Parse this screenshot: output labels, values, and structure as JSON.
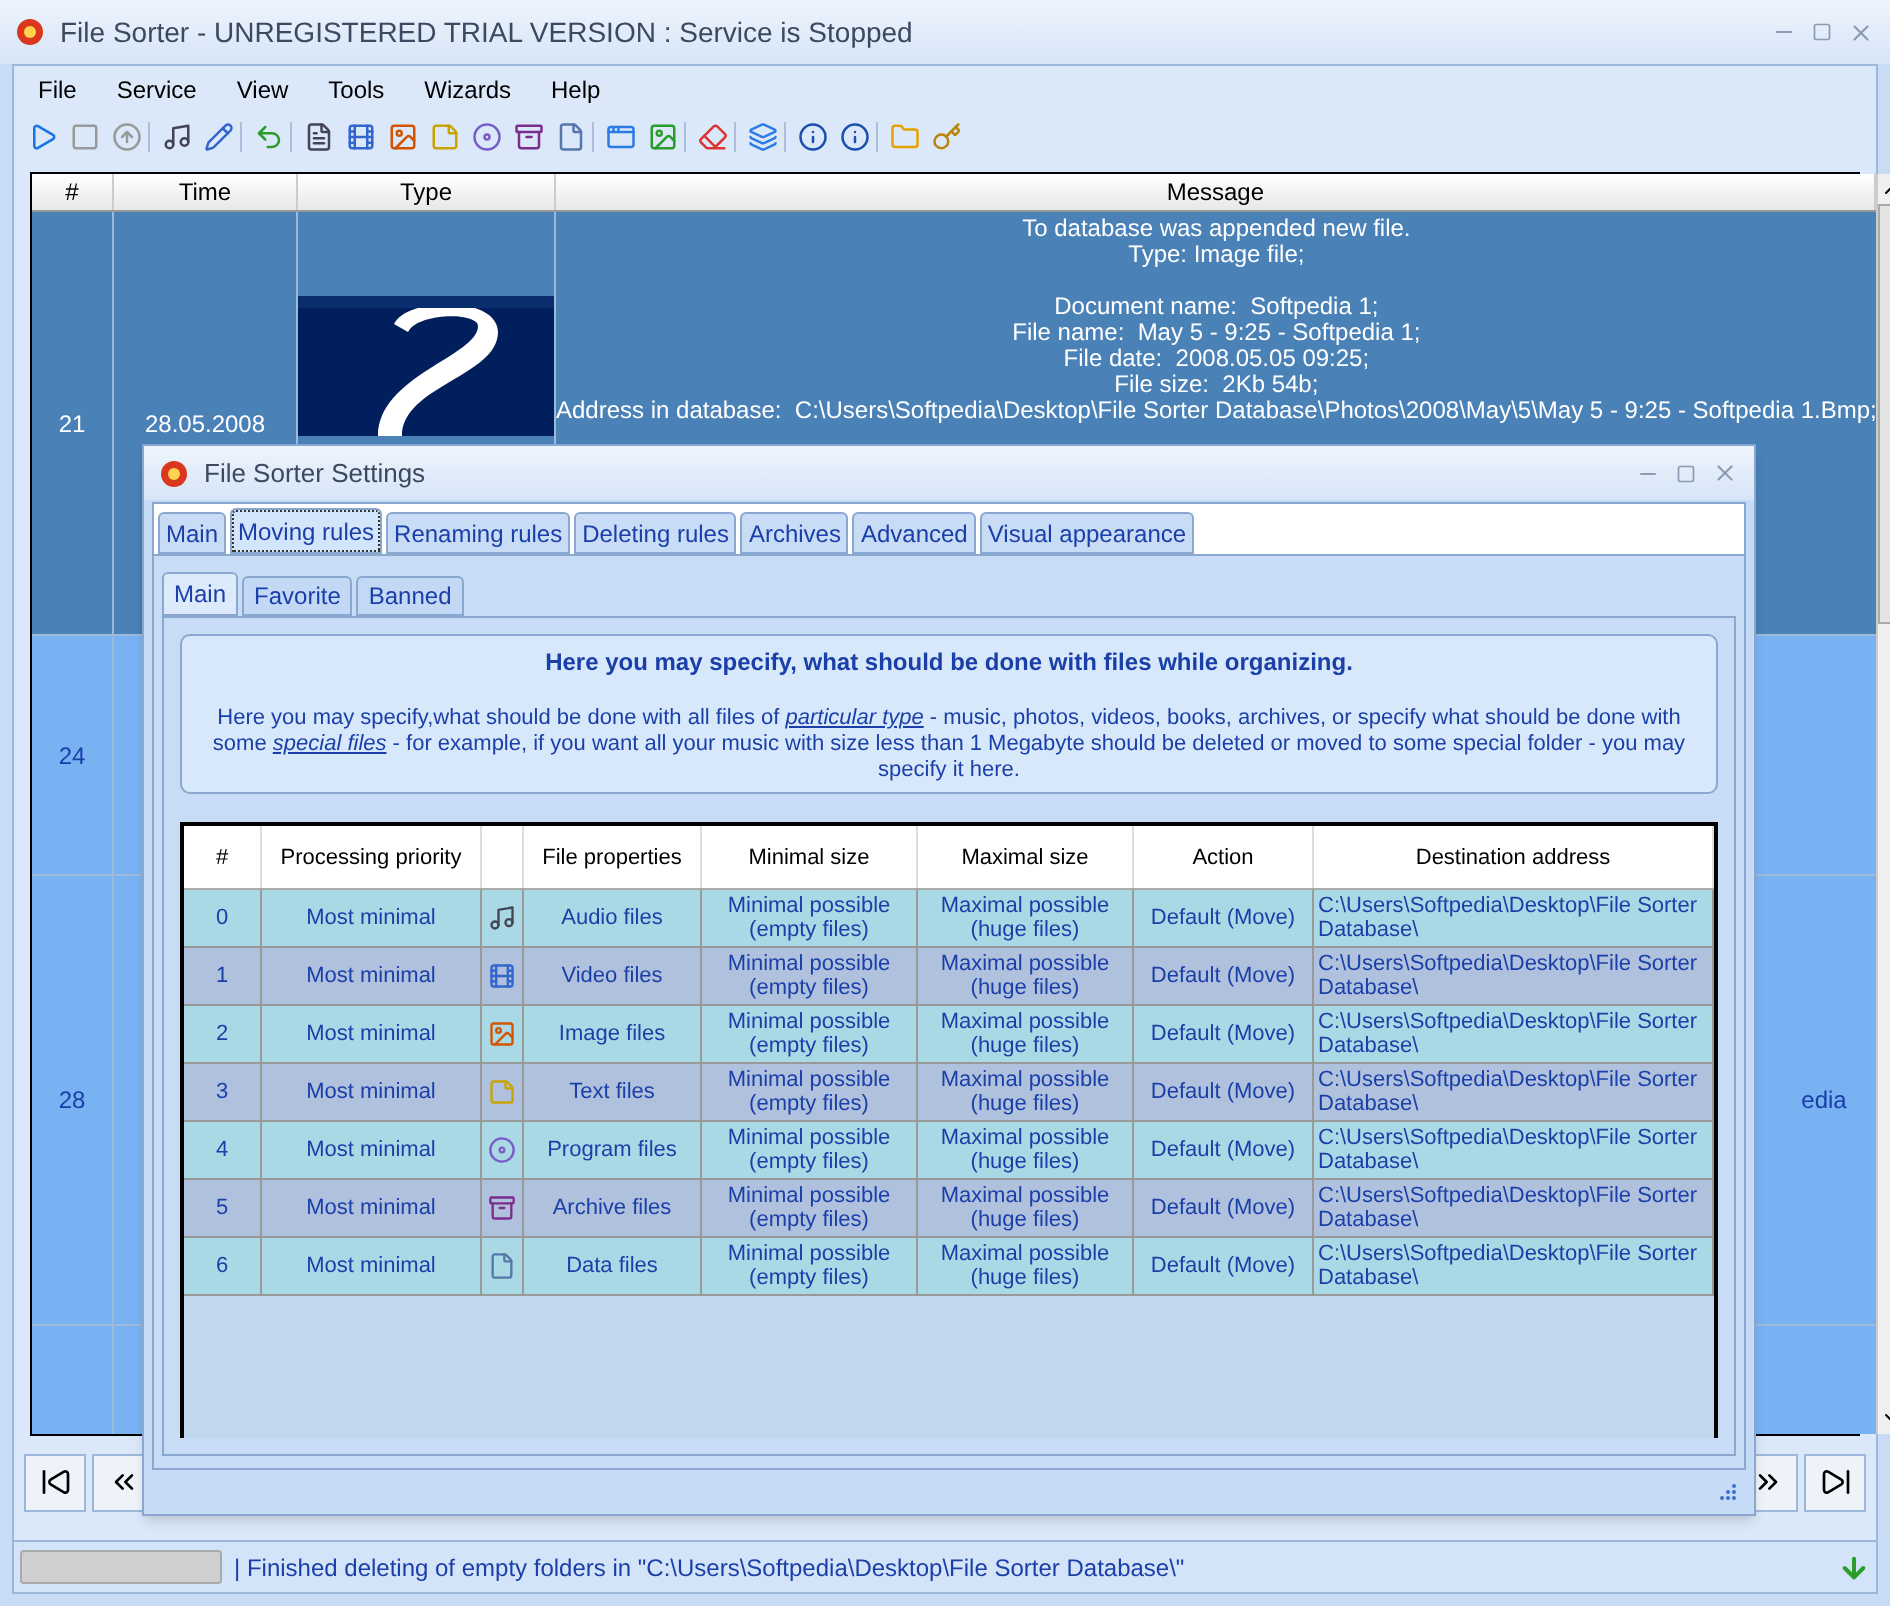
{
  "window": {
    "title": "File Sorter - UNREGISTERED TRIAL VERSION : Service is Stopped"
  },
  "menu": [
    "File",
    "Service",
    "View",
    "Tools",
    "Wizards",
    "Help"
  ],
  "log": {
    "columns": [
      "#",
      "Time",
      "Type",
      "Message"
    ],
    "rows": [
      {
        "num": "21",
        "time": "28.05.2008",
        "type": {
          "kind": "picture"
        },
        "message": [
          [
            "To database was appended new file.",
            "Type: Image file;"
          ],
          [
            "Document name:  Softpedia 1;",
            "File name:  May 5 - 9:25 - Softpedia 1;",
            "File date:  2008.05.05 09:25;",
            "File size:  2Kb 54b;",
            "Address in database:  C:\\Users\\Softpedia\\Desktop\\File Sorter Database\\Photos\\2008\\May\\5\\May 5 - 9:25 - Softpedia 1.Bmp;"
          ]
        ]
      },
      {
        "num": "24"
      },
      {
        "num": "28",
        "message_tail": "edia"
      }
    ]
  },
  "status": {
    "progress": {
      "level": 0
    },
    "text": "| Finished deleting of empty folders in \"C:\\Users\\Softpedia\\Desktop\\File Sorter Database\\\""
  },
  "dialog": {
    "title": "File Sorter Settings",
    "tabs": [
      {
        "label": "Main",
        "selected": false
      },
      {
        "label": "Moving rules",
        "selected": true
      },
      {
        "label": "Renaming rules",
        "selected": false
      },
      {
        "label": "Deleting rules",
        "selected": false
      },
      {
        "label": "Archives",
        "selected": false
      },
      {
        "label": "Advanced",
        "selected": false
      },
      {
        "label": "Visual appearance",
        "selected": false
      }
    ],
    "subtabs": [
      {
        "label": "Main",
        "selected": true
      },
      {
        "label": "Favorite",
        "selected": false
      },
      {
        "label": "Banned",
        "selected": false
      }
    ],
    "info": {
      "heading": "Here you may specify, what should be done with files while organizing.",
      "parts": [
        {
          "kind": "text",
          "text": "Here you may specify,what should be done with all files of "
        },
        {
          "kind": "link",
          "text": "particular type"
        },
        {
          "kind": "text",
          "text": " - music, photos, videos, books, archives, or specify what should be done with some "
        },
        {
          "kind": "link",
          "text": "special files"
        },
        {
          "kind": "text",
          "text": " - for example, if you want all your music with size less than 1 Megabyte should be deleted or moved to some special folder - you may specify it here."
        }
      ]
    },
    "table": {
      "columns": [
        "#",
        "Processing priority",
        "File properties",
        "Minimal size",
        "Maximal size",
        "Action",
        "Destination address"
      ],
      "rows": [
        {
          "num": "0",
          "priority": "Most minimal",
          "file": "Audio files",
          "min": "Minimal possible (empty files)",
          "max": "Maximal possible (huge files)",
          "action": "Default (Move)",
          "dest": "C:\\Users\\Softpedia\\Desktop\\File Sorter Database\\"
        },
        {
          "num": "1",
          "priority": "Most minimal",
          "file": "Video files",
          "min": "Minimal possible (empty files)",
          "max": "Maximal possible (huge files)",
          "action": "Default (Move)",
          "dest": "C:\\Users\\Softpedia\\Desktop\\File Sorter Database\\"
        },
        {
          "num": "2",
          "priority": "Most minimal",
          "file": "Image files",
          "min": "Minimal possible (empty files)",
          "max": "Maximal possible (huge files)",
          "action": "Default (Move)",
          "dest": "C:\\Users\\Softpedia\\Desktop\\File Sorter Database\\"
        },
        {
          "num": "3",
          "priority": "Most minimal",
          "file": "Text files",
          "min": "Minimal possible (empty files)",
          "max": "Maximal possible (huge files)",
          "action": "Default (Move)",
          "dest": "C:\\Users\\Softpedia\\Desktop\\File Sorter Database\\"
        },
        {
          "num": "4",
          "priority": "Most minimal",
          "file": "Program files",
          "min": "Minimal possible (empty files)",
          "max": "Maximal possible (huge files)",
          "action": "Default (Move)",
          "dest": "C:\\Users\\Softpedia\\Desktop\\File Sorter Database\\"
        },
        {
          "num": "5",
          "priority": "Most minimal",
          "file": "Archive files",
          "min": "Minimal possible (empty files)",
          "max": "Maximal possible (huge files)",
          "action": "Default (Move)",
          "dest": "C:\\Users\\Softpedia\\Desktop\\File Sorter Database\\"
        },
        {
          "num": "6",
          "priority": "Most minimal",
          "file": "Data files",
          "min": "Minimal possible (empty files)",
          "max": "Maximal possible (huge files)",
          "action": "Default (Move)",
          "dest": "C:\\Users\\Softpedia\\Desktop\\File Sorter Database\\"
        }
      ]
    }
  }
}
